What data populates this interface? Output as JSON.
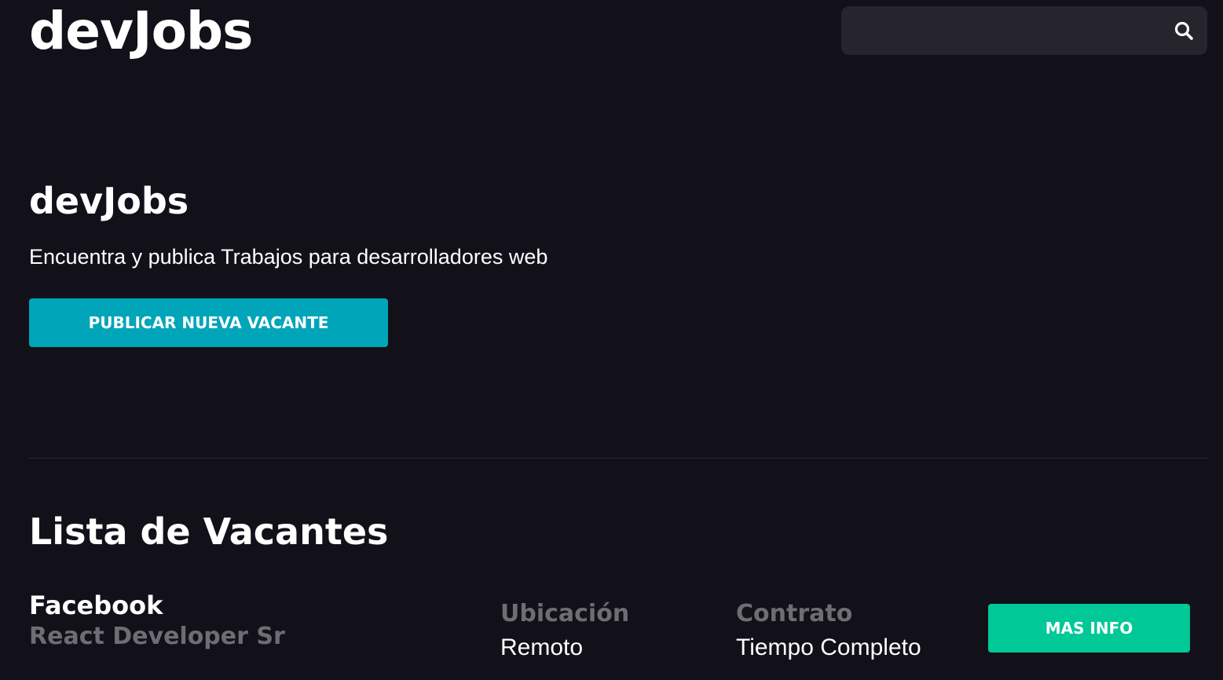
{
  "header": {
    "logo": "devJobs",
    "search": {
      "value": "",
      "placeholder": "",
      "icon": "search-icon"
    }
  },
  "hero": {
    "title": "devJobs",
    "subtitle": "Encuentra y publica Trabajos para desarrolladores web",
    "publish_button": "PUBLICAR NUEVA VACANTE"
  },
  "vacancies": {
    "heading": "Lista de Vacantes",
    "items": [
      {
        "company": "Facebook",
        "title": "React Developer Sr",
        "location_label": "Ubicación",
        "location": "Remoto",
        "contract_label": "Contrato",
        "contract": "Tiempo Completo",
        "info_button": "MAS INFO"
      }
    ]
  },
  "colors": {
    "background": "#12111a",
    "search_bg": "#26252e",
    "publish_button": "#00a5b9",
    "info_button": "#00c896",
    "muted_text": "#6e6d73"
  }
}
